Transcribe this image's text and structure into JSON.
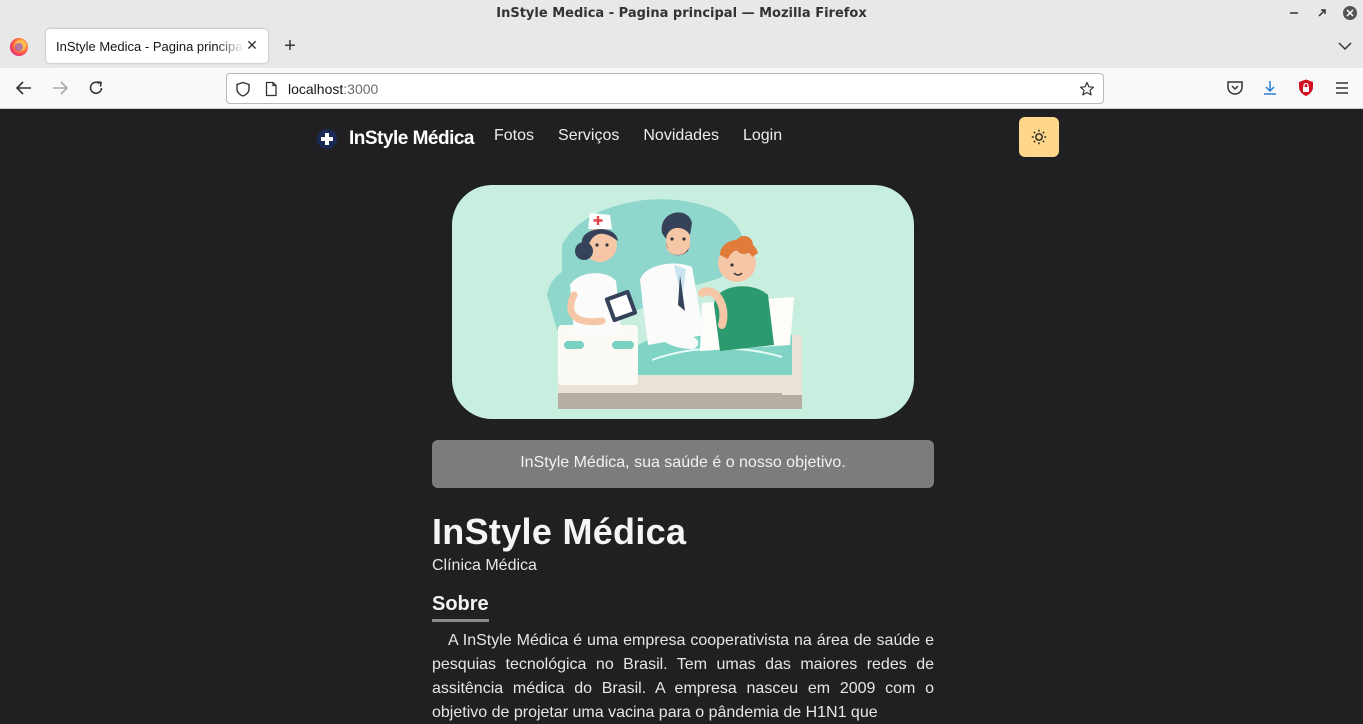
{
  "browser": {
    "window_title": "InStyle Medica - Pagina principal — Mozilla Firefox",
    "tab_title": "InStyle Medica - Pagina principal",
    "url_host": "localhost",
    "url_port": ":3000"
  },
  "site": {
    "brand": "InStyle Médica",
    "menu": [
      "Fotos",
      "Serviços",
      "Novidades",
      "Login"
    ],
    "tagline": "InStyle Médica, sua saúde é o nosso objetivo.",
    "heading": "InStyle Médica",
    "subheading": "Clínica Médica",
    "about_title": "Sobre",
    "about_text": "A InStyle Médica é uma empresa cooperativista na área de saúde e pesquias tecnológica no Brasil. Tem umas das maiores redes de assitência médica do Brasil. A empresa nasceu em 2009 com o objetivo de projetar uma vacina para o pândemia de H1N1 que"
  },
  "colors": {
    "page_bg": "#202022",
    "theme_button": "#ffd78a",
    "banner_bg": "#7c7c7c",
    "hero_bg": "#c8eedf"
  }
}
